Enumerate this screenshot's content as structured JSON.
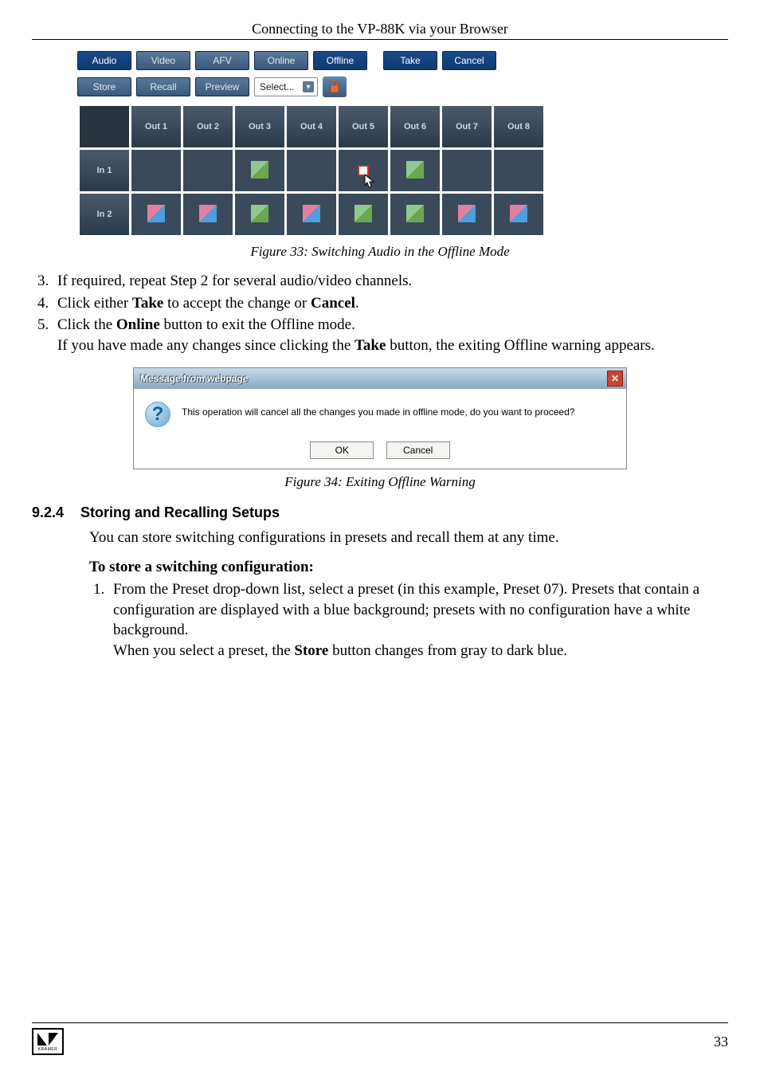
{
  "header": {
    "title": "Connecting to the VP-88K via your Browser"
  },
  "switcher": {
    "row1": {
      "audio": "Audio",
      "video": "Video",
      "afv": "AFV",
      "online": "Online",
      "offline": "Offline",
      "take": "Take",
      "cancel": "Cancel"
    },
    "row2": {
      "store": "Store",
      "recall": "Recall",
      "preview": "Preview",
      "select": "Select..."
    },
    "cols": [
      "Out 1",
      "Out 2",
      "Out 3",
      "Out 4",
      "Out 5",
      "Out 6",
      "Out 7",
      "Out 8"
    ],
    "rows": [
      "In 1",
      "In 2"
    ]
  },
  "fig33": "Figure 33: Switching Audio in the Offline Mode",
  "steps": {
    "s3": "If required, repeat Step 2 for several audio/video channels.",
    "s4a": "Click either ",
    "s4b": "Take",
    "s4c": " to accept the change or ",
    "s4d": "Cancel",
    "s4e": ".",
    "s5a": "Click the ",
    "s5b": "Online",
    "s5c": " button to exit the Offline mode.",
    "s5d": "If you have made any changes since clicking the ",
    "s5e": "Take",
    "s5f": " button, the exiting Offline warning appears."
  },
  "dialog": {
    "title": "Message from webpage",
    "msg": "This operation will cancel all the changes you made in offline mode, do you want to proceed?",
    "ok": "OK",
    "cancel": "Cancel"
  },
  "fig34": "Figure 34: Exiting Offline Warning",
  "sec": {
    "num": "9.2.4",
    "title": "Storing and Recalling Setups"
  },
  "para1": "You can store switching configurations in presets and recall them at any time.",
  "subhead": "To store a switching configuration:",
  "steps2": {
    "l1a": "From the Preset drop-down list, select a preset (in this example, Preset 07). Presets that contain a configuration are displayed with a blue background; presets with no configuration have a white background.",
    "l1b": "When you select a preset, the ",
    "l1c": "Store",
    "l1d": " button changes from gray to dark blue."
  },
  "footer": {
    "brand": "KRAMER",
    "page": "33"
  }
}
